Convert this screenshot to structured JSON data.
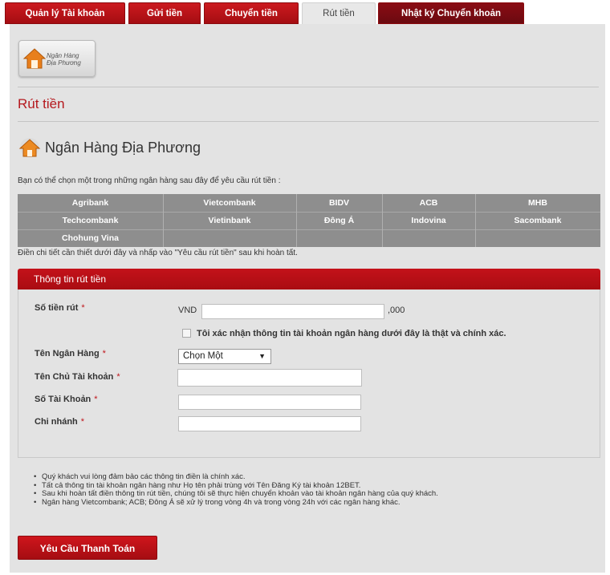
{
  "tabs": [
    {
      "label": "Quản lý Tài khoản"
    },
    {
      "label": "Gửi tiền"
    },
    {
      "label": "Chuyển tiền"
    },
    {
      "label": "Rút tiền"
    },
    {
      "label": "Nhật ký Chuyển khoản"
    }
  ],
  "logo": {
    "line1": "Ngân Hàng",
    "line2": "Địa Phương"
  },
  "page_title": "Rút tiền",
  "bank_section": {
    "title": "Ngân Hàng Địa Phương",
    "instruction": "Bạn có thể chọn một trong những ngân hàng sau đây để yêu cầu rút tiền :",
    "banks": [
      [
        "Agribank",
        "Vietcombank",
        "BIDV",
        "ACB",
        "MHB"
      ],
      [
        "Techcombank",
        "Vietinbank",
        "Đông Á",
        "Indovina",
        "Sacombank"
      ],
      [
        "Chohung Vina",
        "",
        "",
        "",
        ""
      ]
    ],
    "detail_note": "Điền chi tiết cần thiết dưới đây và nhấp vào \"Yêu cầu rút tiền\" sau khi hoàn tất."
  },
  "form": {
    "header": "Thông tin rút tiền",
    "amount": {
      "label": "Số tiền rút",
      "required": "*",
      "prefix": "VND",
      "suffix": ",000",
      "value": ""
    },
    "confirm_text": "Tôi xác nhận thông tin tài khoản ngân hàng dưới đây là thật và chính xác.",
    "bank_name": {
      "label": "Tên Ngân Hàng",
      "required": "*",
      "selected": "Chọn Một"
    },
    "holder_name": {
      "label": "Tên Chủ Tài khoản",
      "required": "*",
      "value": ""
    },
    "account_number": {
      "label": "Số Tài Khoản",
      "required": "*",
      "value": ""
    },
    "branch": {
      "label": "Chi nhánh",
      "required": "*",
      "value": ""
    }
  },
  "notes": [
    "Quý khách vui lòng đảm bảo các thông tin điền là chính xác.",
    "Tất cả thông tin tài khoản ngân hàng như Họ tên phải trùng với Tên Đăng Ký tài khoản 12BET.",
    "Sau khi hoàn tất điền thông tin rút tiền, chúng tôi sẽ thực hiện chuyển khoản vào tài khoản ngân hàng của quý khách.",
    "Ngân hàng Vietcombank; ACB; Đông Á sẽ xử lý trong vòng 4h và trong vòng 24h với các ngân hàng khác."
  ],
  "submit_label": "Yêu Cầu Thanh Toán",
  "colors": {
    "brand_red": "#b5191e",
    "panel_bg": "#e3e3e3",
    "grid_bg": "#8e8e8e"
  }
}
